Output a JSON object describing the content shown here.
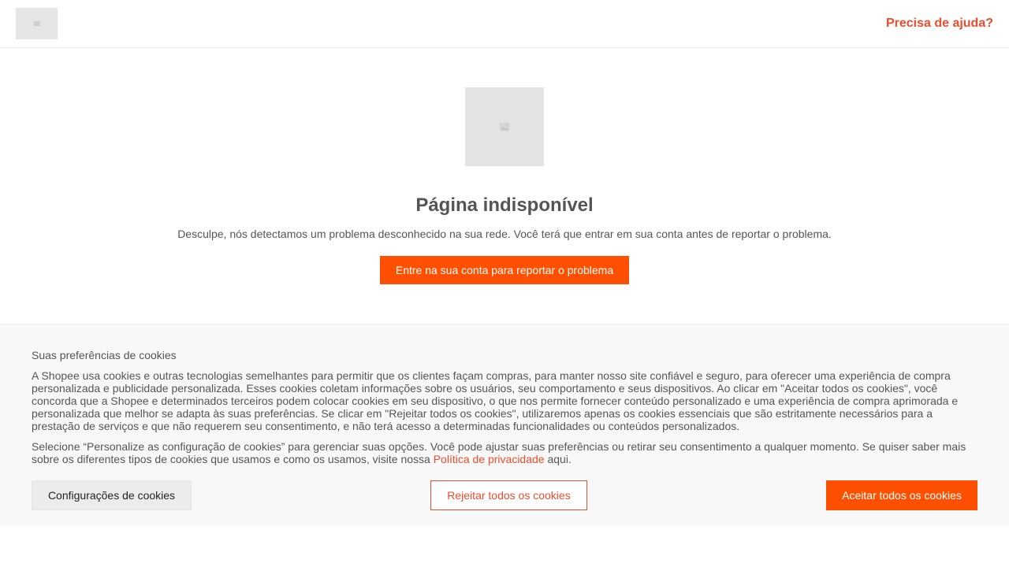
{
  "header": {
    "logo_icon": "image-placeholder-icon",
    "help_link": "Precisa de ajuda?"
  },
  "main": {
    "image_icon": "image-placeholder-icon",
    "title": "Página indisponível",
    "description": "Desculpe, nós detectamos um problema desconhecido na sua rede. Você terá que entrar em sua conta antes de reportar o problema.",
    "login_button": "Entre na sua conta para reportar o problema"
  },
  "cookies": {
    "title": "Suas preferências de cookies",
    "paragraph1": "A Shopee usa cookies e outras tecnologias semelhantes para permitir que os clientes façam compras, para manter nosso site confiável e seguro, para oferecer uma experiência de compra personalizada e publicidade personalizada. Esses cookies coletam informações sobre os usuários, seu comportamento e seus dispositivos. Ao clicar em \"Aceitar todos os cookies\", você concorda que a Shopee e determinados terceiros podem colocar cookies em seu dispositivo, o que nos permite fornecer conteúdo personalizado e uma experiência de compra aprimorada e personalizada que melhor se adapta às suas preferências. Se clicar em \"Rejeitar todos os cookies\", utilizaremos apenas os cookies essenciais que são estritamente necessários para a prestação de serviços e que não requerem seu consentimento, e não terá acesso a determinadas funcionalidades ou conteúdos personalizados.",
    "paragraph2_before": "Selecione “Personalize as configuração de cookies” para gerenciar suas opções. Você pode ajustar suas preferências ou retirar seu consentimento a qualquer momento. Se quiser saber mais sobre os diferentes tipos de cookies que usamos e como os usamos, visite nossa ",
    "privacy_link": "Política de privacidade",
    "paragraph2_after": " aqui.",
    "settings_button": "Configurações de cookies",
    "reject_button": "Rejeitar todos os cookies",
    "accept_button": "Aceitar todos os cookies"
  },
  "colors": {
    "brand": "#ee4d2d",
    "primary_button": "#fe5000",
    "text": "#555555",
    "panel_bg": "#f8f8f8"
  }
}
